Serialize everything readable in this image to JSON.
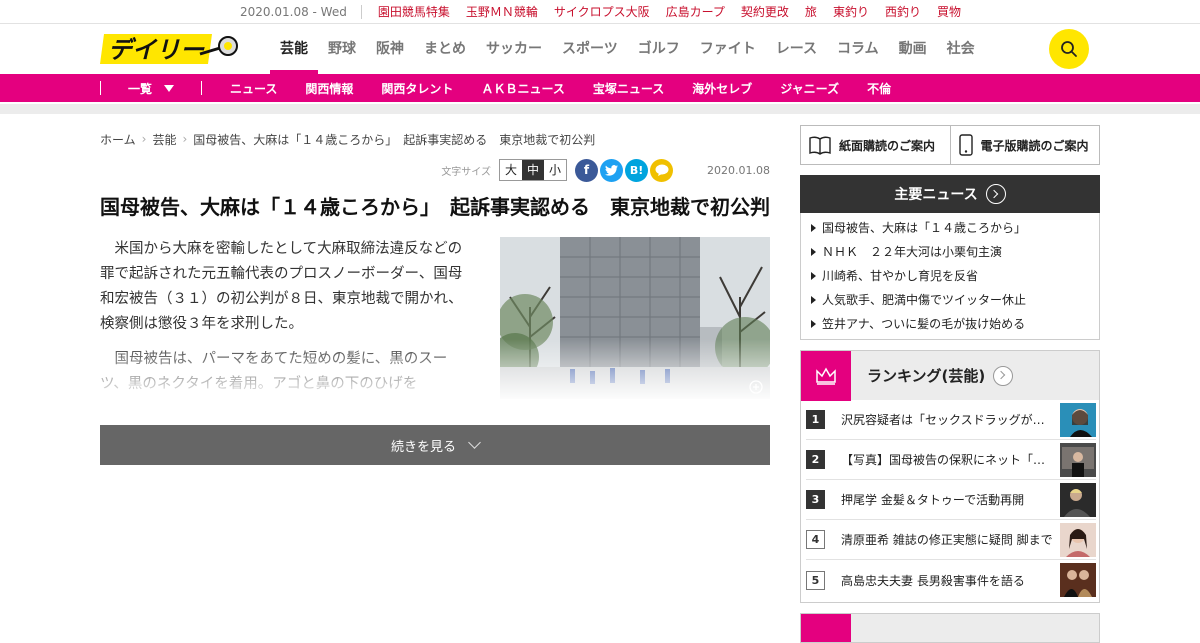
{
  "topbar": {
    "date": "2020.01.08 - Wed",
    "links": [
      "園田競馬特集",
      "玉野ＭＮ競輪",
      "サイクロプス大阪",
      "広島カープ",
      "契約更改",
      "旅",
      "東釣り",
      "西釣り",
      "買物"
    ]
  },
  "header": {
    "logo_alt": "デイリー",
    "nav": [
      "芸能",
      "野球",
      "阪神",
      "まとめ",
      "サッカー",
      "スポーツ",
      "ゴルフ",
      "ファイト",
      "レース",
      "コラム",
      "動画",
      "社会"
    ],
    "active": "芸能"
  },
  "subnav": {
    "ichiran": "一覧",
    "items": [
      "ニュース",
      "関西情報",
      "関西タレント",
      "ＡＫＢニュース",
      "宝塚ニュース",
      "海外セレブ",
      "ジャニーズ",
      "不倫"
    ]
  },
  "breadcrumb": [
    "ホーム",
    "芸能",
    "国母被告、大麻は「１４歳ころから」　起訴事実認める　東京地裁で初公判"
  ],
  "tools": {
    "font_size_label": "文字サイズ",
    "font_sizes": [
      "大",
      "中",
      "小"
    ],
    "selected_size": "中",
    "share": [
      "facebook-icon",
      "twitter-icon",
      "hatena-icon",
      "line-icon"
    ],
    "hatena_text": "B!",
    "date": "2020.01.08"
  },
  "article": {
    "title": "国母被告、大麻は「１４歳ころから」　起訴事実認める　東京地裁で初公判",
    "paragraphs": [
      "米国から大麻を密輸したとして大麻取締法違反などの罪で起訴された元五輪代表のプロスノーボーダー、国母和宏被告（３１）の初公判が８日、東京地裁で開かれ、検察側は懲役３年を求刑した。",
      "国母被告は、パーマをあてた短めの髪に、黒のスーツ、黒のネクタイを着用。アゴと鼻の下のひげを"
    ],
    "more_label": "続きを見る"
  },
  "sidebar": {
    "subscribe_paper": "紙面購読のご案内",
    "subscribe_digital": "電子版購読のご案内",
    "news_title": "主要ニュース",
    "news": [
      "国母被告、大麻は「１４歳ころから」",
      "ＮＨＫ　２２年大河は小栗旬主演",
      "川崎希、甘やかし育児を反省",
      "人気歌手、肥満中傷でツイッター休止",
      "笠井アナ、ついに髪の毛が抜け始める"
    ],
    "ranking_title": "ランキング(芸能)",
    "ranking": [
      {
        "rank": "1",
        "text": "沢尻容疑者は「セックスドラッグが多…"
      },
      {
        "rank": "2",
        "text": "【写真】国母被告の保釈にネット「ブ…"
      },
      {
        "rank": "3",
        "text": "押尾学 金髪＆タトゥーで活動再開"
      },
      {
        "rank": "4",
        "text": "清原亜希 雑誌の修正実態に疑問 脚まで"
      },
      {
        "rank": "5",
        "text": "高島忠夫夫妻 長男殺害事件を語る"
      }
    ]
  },
  "colors": {
    "brand_pink": "#e4007f",
    "brand_yellow": "#ffe600",
    "link_red": "#c8102e"
  }
}
